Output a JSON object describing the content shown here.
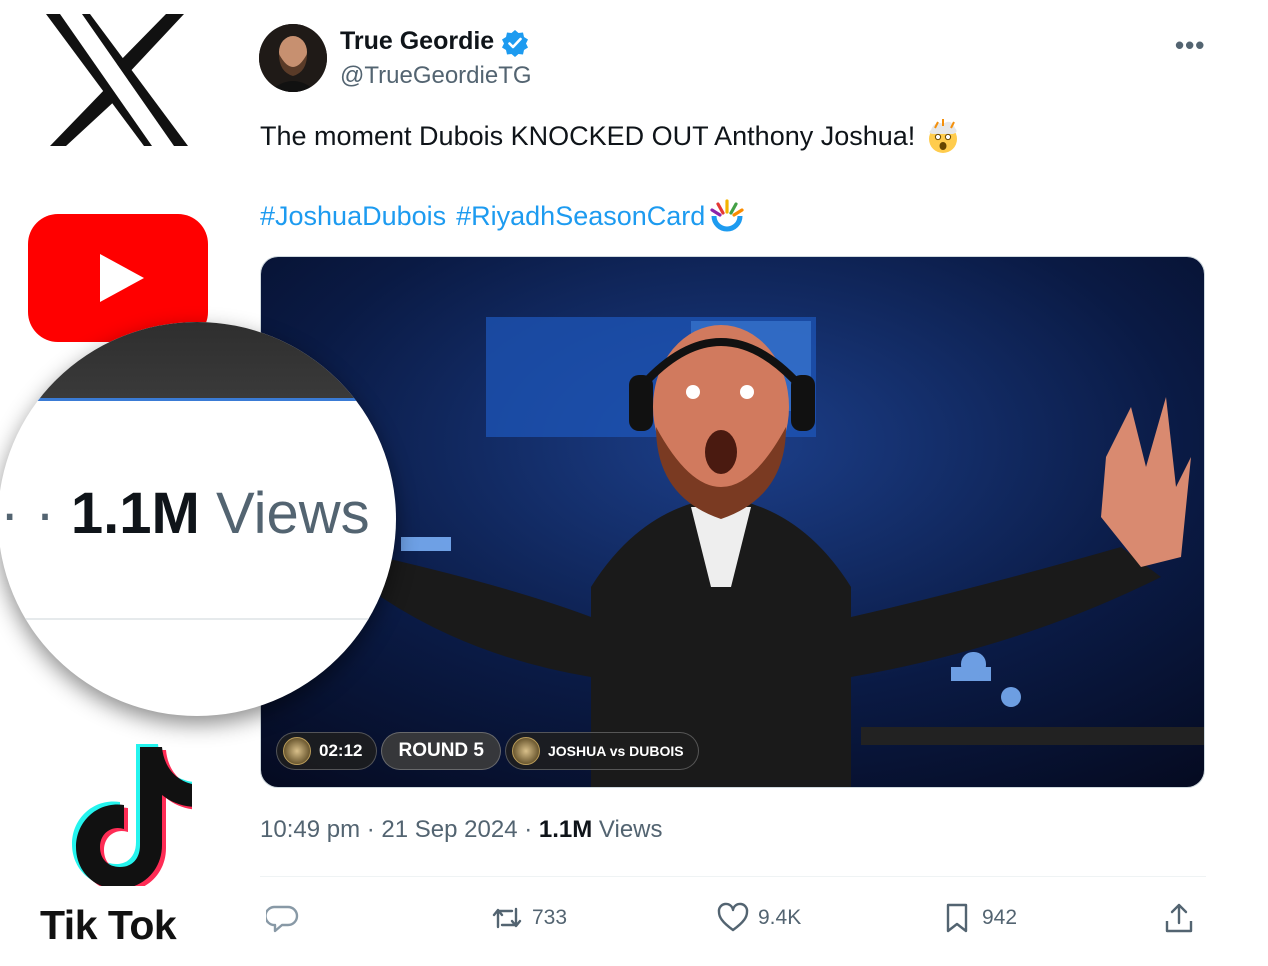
{
  "brand_logos": {
    "x": "x-logo",
    "youtube": "youtube-play-logo",
    "tiktok": "tiktok-logo",
    "tiktok_label": "Tik Tok"
  },
  "tweet": {
    "display_name": "True Geordie",
    "handle": "@TrueGeordieTG",
    "more_label": "•••",
    "text": "The moment Dubois KNOCKED OUT Anthony Joshua!",
    "text_emoji": "exploding-head-emoji",
    "hashtags": [
      "#JoshuaDubois",
      "#RiyadhSeasonCard"
    ],
    "hashtag_emoji": "riyadh-season-emoji",
    "media": {
      "description_icon": "video-still",
      "clock": "02:12",
      "round": "ROUND 5",
      "matchup": "JOSHUA vs DUBOIS"
    },
    "time": "10:49 pm",
    "separator": "·",
    "date": "21 Sep 2024",
    "views_count": "1.1M",
    "views_label": "Views",
    "actions": {
      "reply": "",
      "retweet": "733",
      "like": "9.4K",
      "bookmark": "942",
      "share": ""
    }
  },
  "magnifier": {
    "prefix": "· ·",
    "views_count": "1.1M",
    "views_label": "Views"
  },
  "colors": {
    "link": "#1d9bf0",
    "secondary_text": "#536471",
    "youtube_red": "#ff0000",
    "verified": "#1d9bf0"
  }
}
